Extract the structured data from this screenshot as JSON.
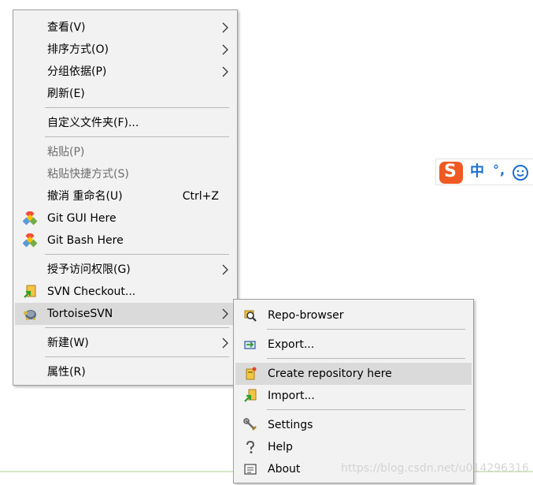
{
  "main_menu": {
    "view": "查看(V)",
    "sort_by": "排序方式(O)",
    "group_by": "分组依据(P)",
    "refresh": "刷新(E)",
    "customize_folder": "自定义文件夹(F)...",
    "paste": "粘贴(P)",
    "paste_shortcut": "粘贴快捷方式(S)",
    "undo_rename": "撤消 重命名(U)",
    "undo_shortcut": "Ctrl+Z",
    "git_gui": "Git GUI Here",
    "git_bash": "Git Bash Here",
    "give_access": "授予访问权限(G)",
    "svn_checkout": "SVN Checkout...",
    "tortoise_svn": "TortoiseSVN",
    "new": "新建(W)",
    "properties": "属性(R)"
  },
  "svn_submenu": {
    "repo_browser": "Repo-browser",
    "export": "Export...",
    "create_repository": "Create repository here",
    "import": "Import...",
    "settings": "Settings",
    "help": "Help",
    "about": "About"
  },
  "ime_toolbar": {
    "logo": "S",
    "mode": "中",
    "punctuation": "°,"
  },
  "watermark": "https://blog.csdn.net/u014296316",
  "colors": {
    "menu_bg": "#f2f2f2",
    "highlight": "#dadada",
    "disabled_text": "#6d6d6d",
    "ime_blue": "#1b6fd1",
    "sogou_orange": "#f05a22"
  }
}
